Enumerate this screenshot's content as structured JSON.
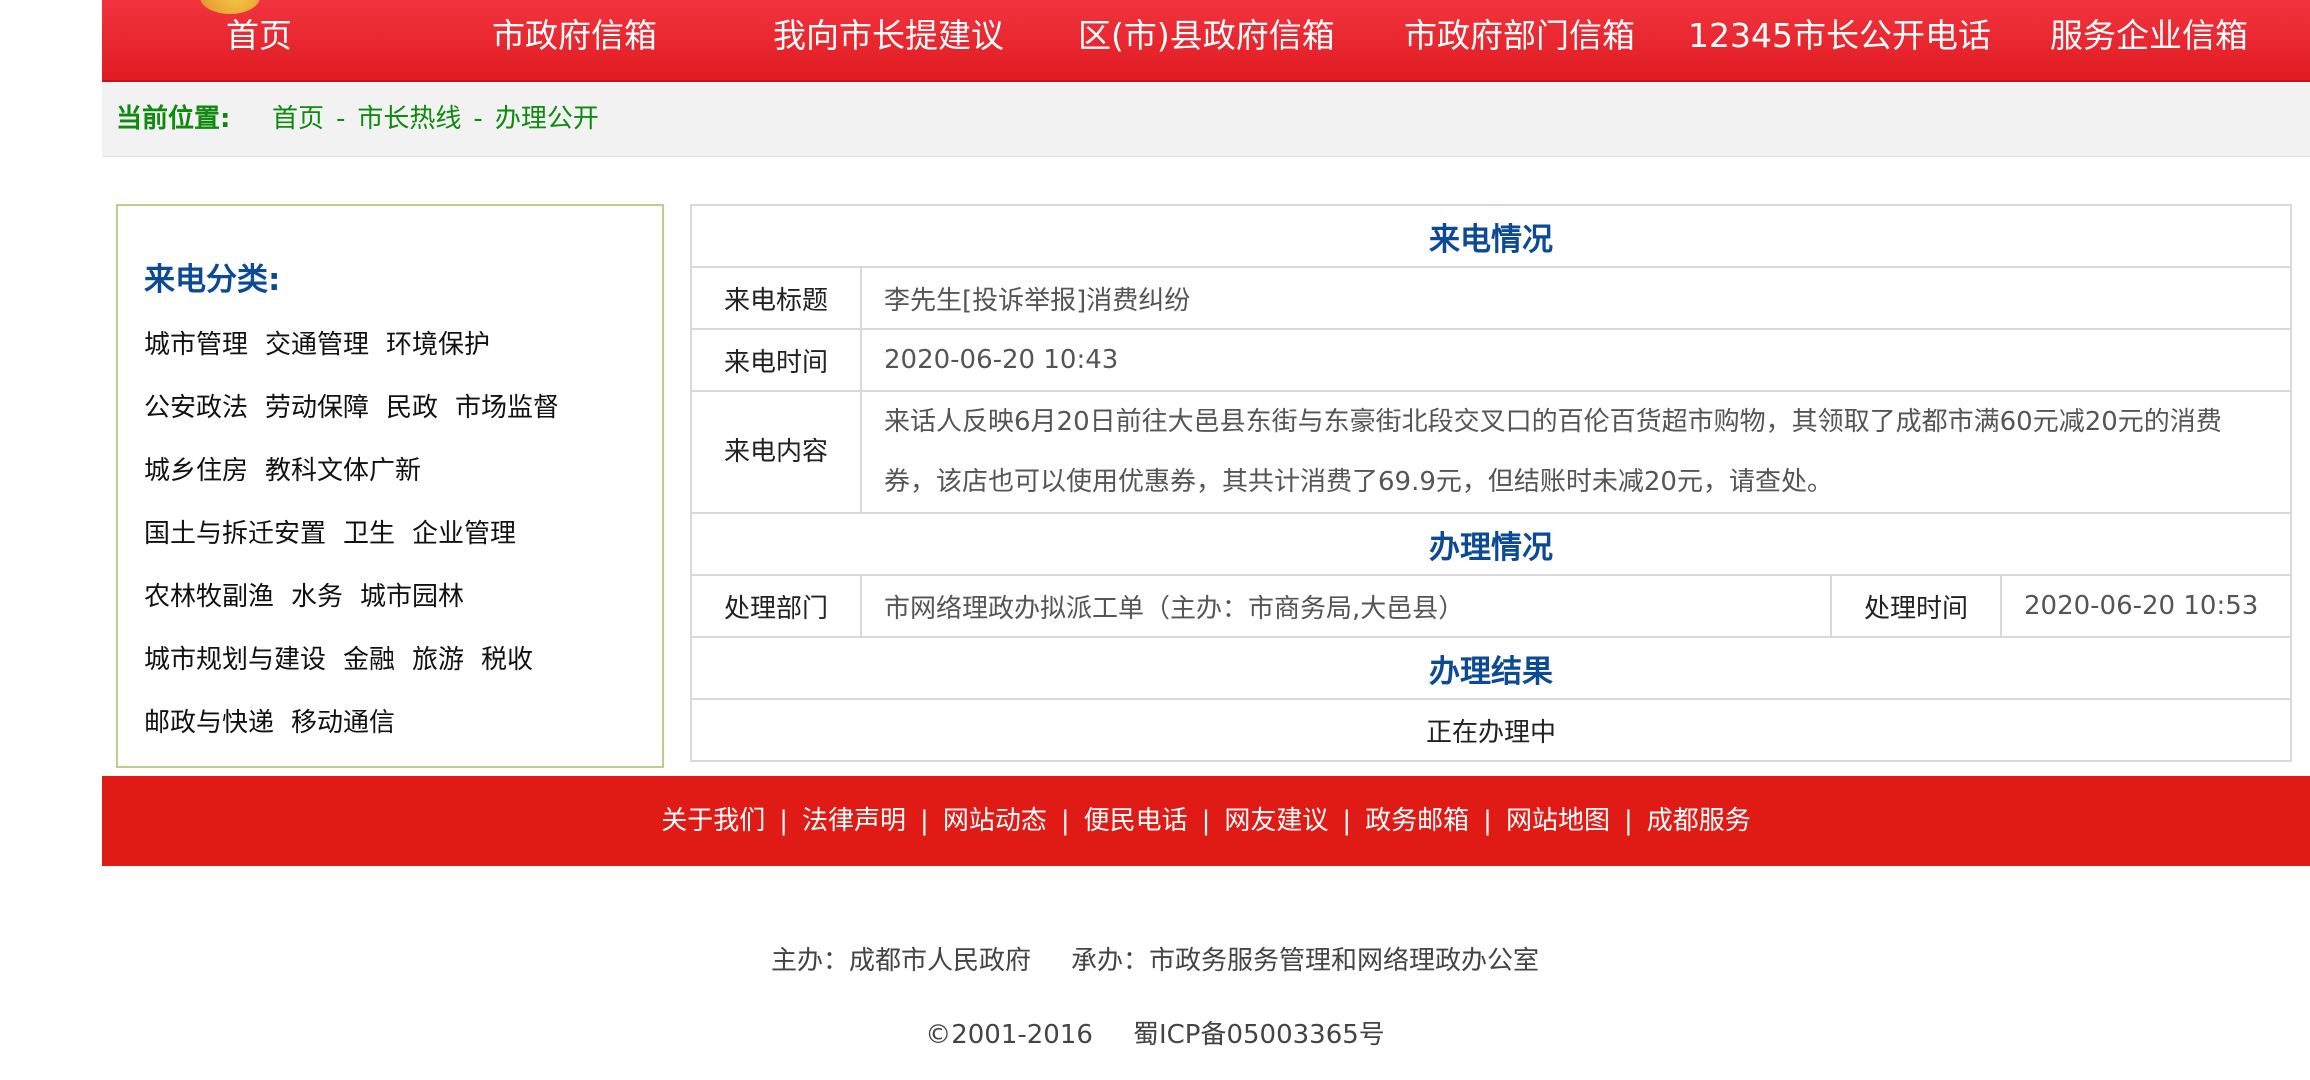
{
  "nav": {
    "items": [
      "首页",
      "市政府信箱",
      "我向市长提建议",
      "区(市)县政府信箱",
      "市政府部门信箱",
      "12345市长公开电话",
      "服务企业信箱"
    ]
  },
  "breadcrumb": {
    "label": "当前位置:",
    "links": [
      "首页",
      "市长热线",
      "办理公开"
    ]
  },
  "category": {
    "title": "来电分类:",
    "rows": [
      [
        "城市管理",
        "交通管理",
        "环境保护"
      ],
      [
        "公安政法",
        "劳动保障",
        "民政",
        "市场监督"
      ],
      [
        "城乡住房",
        "教科文体广新"
      ],
      [
        "国土与拆迁安置",
        "卫生",
        "企业管理"
      ],
      [
        "农林牧副渔",
        "水务",
        "城市园林"
      ],
      [
        "城市规划与建设",
        "金融",
        "旅游",
        "税收"
      ],
      [
        "邮政与快递",
        "移动通信"
      ]
    ]
  },
  "call": {
    "section_title": "来电情况",
    "title_label": "来电标题",
    "title_value": "李先生[投诉举报]消费纠纷",
    "time_label": "来电时间",
    "time_value": "2020-06-20 10:43",
    "content_label": "来电内容",
    "content_value": "来话人反映6月20日前往大邑县东街与东豪街北段交叉口的百伦百货超市购物，其领取了成都市满60元减20元的消费券，该店也可以使用优惠券，其共计消费了69.9元，但结账时未减20元，请查处。"
  },
  "handling": {
    "section_title": "办理情况",
    "dept_label": "处理部门",
    "dept_value": "市网络理政办拟派工单（主办：市商务局,大邑县）",
    "time_label": "处理时间",
    "time_value": "2020-06-20 10:53"
  },
  "result": {
    "section_title": "办理结果",
    "value": "正在办理中"
  },
  "footer": {
    "links": [
      "关于我们",
      "法律声明",
      "网站动态",
      "便民电话",
      "网友建议",
      "政务邮箱",
      "网站地图",
      "成都服务"
    ],
    "separator": "|",
    "host": "主办：成都市人民政府",
    "organizer": "承办：市政务服务管理和网络理政办公室",
    "copyright": "©2001-2016",
    "icp": "蜀ICP备05003365号"
  }
}
